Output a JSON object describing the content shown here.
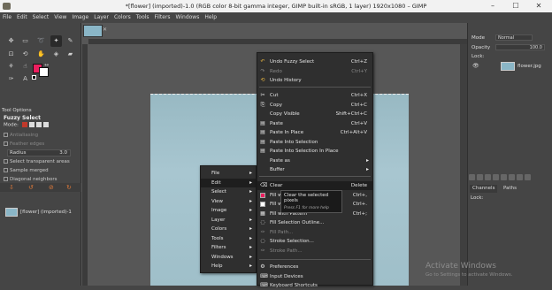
{
  "titlebar": {
    "title": "*[flower] (imported)-1.0 (RGB color 8-bit gamma integer, GIMP built-in sRGB, 1 layer) 1920x1080 – GIMP",
    "minimize": "–",
    "maximize": "☐",
    "close": "✕"
  },
  "menubar": [
    "File",
    "Edit",
    "Select",
    "View",
    "Image",
    "Layer",
    "Colors",
    "Tools",
    "Filters",
    "Windows",
    "Help"
  ],
  "colors": {
    "foreground": "#ec1f5f",
    "background": "#ffffff",
    "accent": "#e07a3a"
  },
  "tool_options": {
    "tab_label": "Tool Options",
    "title": "Fuzzy Select",
    "mode_label": "Mode:",
    "options": [
      "Antialiasing",
      "Feather edges"
    ],
    "radius_label": "Radius",
    "radius_value": "3.0",
    "more": [
      "Select transparent areas",
      "Sample merged",
      "Diagonal neighbors"
    ]
  },
  "layers_panel": {
    "mode_label": "Mode",
    "mode_value": "Normal",
    "opacity_label": "Opacity",
    "opacity_value": "100.0",
    "lock_label": "Lock:",
    "layer_name": "flower.jpg",
    "channels_tab": "Channels",
    "paths_tab": "Paths",
    "lock2_label": "Lock:"
  },
  "main_menu": [
    "File",
    "Edit",
    "Select",
    "View",
    "Image",
    "Layer",
    "Colors",
    "Tools",
    "Filters",
    "Windows",
    "Help"
  ],
  "edit_menu": [
    {
      "label": "Undo Fuzzy Select",
      "shortcut": "Ctrl+Z",
      "dim": false
    },
    {
      "label": "Redo",
      "shortcut": "Ctrl+Y",
      "dim": true
    },
    {
      "label": "Undo History",
      "shortcut": "",
      "dim": false
    },
    {
      "label": "Cut",
      "shortcut": "Ctrl+X",
      "dim": false
    },
    {
      "label": "Copy",
      "shortcut": "Ctrl+C",
      "dim": false
    },
    {
      "label": "Copy Visible",
      "shortcut": "Shift+Ctrl+C",
      "dim": false
    },
    {
      "label": "Paste",
      "shortcut": "Ctrl+V",
      "dim": false
    },
    {
      "label": "Paste In Place",
      "shortcut": "Ctrl+Alt+V",
      "dim": false
    },
    {
      "label": "Paste Into Selection",
      "shortcut": "",
      "dim": false
    },
    {
      "label": "Paste Into Selection In Place",
      "shortcut": "",
      "dim": false
    },
    {
      "label": "Paste as",
      "shortcut": "",
      "dim": false
    },
    {
      "label": "Buffer",
      "shortcut": "",
      "dim": false
    },
    {
      "label": "Clear",
      "shortcut": "Delete",
      "dim": false
    },
    {
      "label": "Fill wi",
      "shortcut": "Ctrl+,",
      "dim": false
    },
    {
      "label": "Fill wi",
      "shortcut": "Ctrl+.",
      "dim": false
    },
    {
      "label": "Fill with Pattern",
      "shortcut": "Ctrl+;",
      "dim": false
    },
    {
      "label": "Fill Selection Outline...",
      "shortcut": "",
      "dim": false
    },
    {
      "label": "Fill Path...",
      "shortcut": "",
      "dim": true
    },
    {
      "label": "Stroke Selection...",
      "shortcut": "",
      "dim": false
    },
    {
      "label": "Stroke Path...",
      "shortcut": "",
      "dim": true
    },
    {
      "label": "Preferences",
      "shortcut": "",
      "dim": false
    },
    {
      "label": "Input Devices",
      "shortcut": "",
      "dim": false
    },
    {
      "label": "Keyboard Shortcuts",
      "shortcut": "",
      "dim": false
    }
  ],
  "tooltip": {
    "title": "Clear the selected pixels",
    "hint": "Press F1 for more help"
  },
  "watermark": {
    "line1": "Activate Windows",
    "line2": "Go to Settings to activate Windows."
  }
}
